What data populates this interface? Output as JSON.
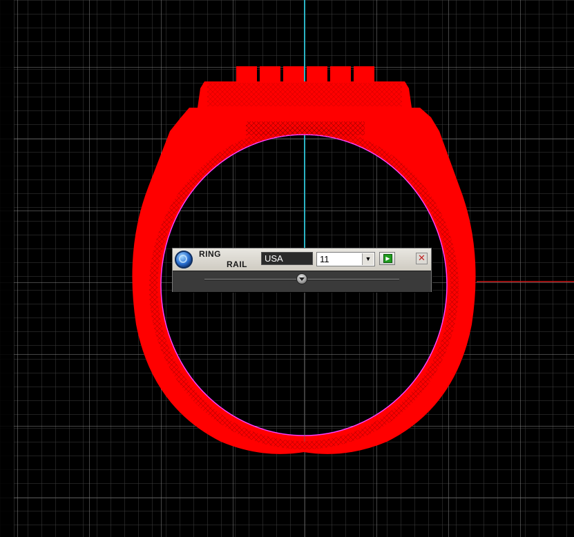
{
  "window": {
    "app": "3D ring modeling viewport"
  },
  "viewport": {
    "background_color": "#000000",
    "grid_color": "#5a5a5a",
    "axis_vertical_color": "#2ab3c4",
    "axis_horizontal_color": "#d01818",
    "model_color": "#ff0000",
    "inner_profile_color": "#ff40ff"
  },
  "ring_panel": {
    "logo_icon": "ring-logo-icon",
    "title_line1": "RING",
    "title_line2": "RAIL",
    "standard_value": "USA",
    "size_value": "11",
    "dropdown_icon": "chevron-down-icon",
    "apply_icon": "play-icon",
    "close_icon": "close-icon",
    "close_glyph": "✕",
    "apply_glyph": "▶",
    "dropdown_glyph": "▼"
  }
}
